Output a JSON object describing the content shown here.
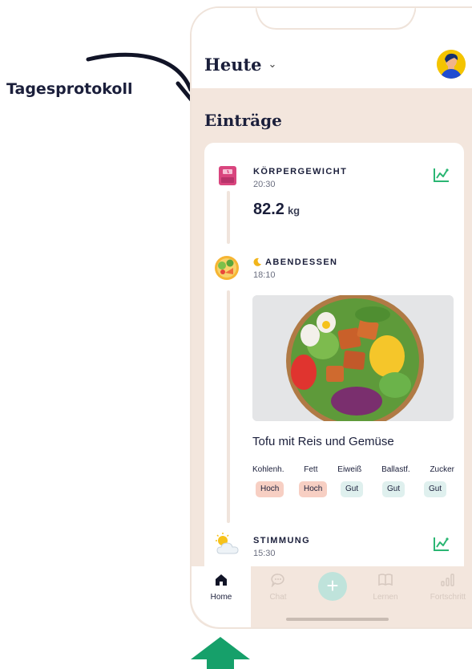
{
  "callout": {
    "label": "Tagesprotokoll"
  },
  "header": {
    "date_label": "Heute",
    "chevron": "chevron-down-icon"
  },
  "section": {
    "title": "Einträge"
  },
  "entries": {
    "weight": {
      "title": "KÖRPERGEWICHT",
      "time": "20:30",
      "value": "82.2",
      "unit": "kg",
      "icon": "scale-icon"
    },
    "dinner": {
      "title": "ABENDESSEN",
      "time": "18:10",
      "icon": "salad-icon",
      "meal_name": "Tofu mit Reis und Gemüse",
      "nutrients": [
        {
          "label": "Kohlenh.",
          "rating": "Hoch",
          "level": "high"
        },
        {
          "label": "Fett",
          "rating": "Hoch",
          "level": "high"
        },
        {
          "label": "Eiweiß",
          "rating": "Gut",
          "level": "good"
        },
        {
          "label": "Ballastf.",
          "rating": "Gut",
          "level": "good"
        },
        {
          "label": "Zucker",
          "rating": "Gut",
          "level": "good"
        }
      ]
    },
    "mood": {
      "title": "STIMMUNG",
      "time": "15:30",
      "icon": "weather-icon"
    }
  },
  "nav": {
    "items": [
      {
        "label": "Home",
        "icon": "home-icon",
        "active": true
      },
      {
        "label": "Chat",
        "icon": "chat-icon",
        "active": false
      },
      {
        "label": "",
        "icon": "plus-icon",
        "active": false
      },
      {
        "label": "Lernen",
        "icon": "book-icon",
        "active": false
      },
      {
        "label": "Fortschritt",
        "icon": "bar-chart-icon",
        "active": false
      }
    ]
  },
  "colors": {
    "background": "#f3e6dd",
    "text": "#1b1f3b",
    "accent_green": "#2bb673",
    "badge_high": "#f7cfc3",
    "badge_good": "#dff0ee",
    "arrow_green": "#16a06a"
  }
}
